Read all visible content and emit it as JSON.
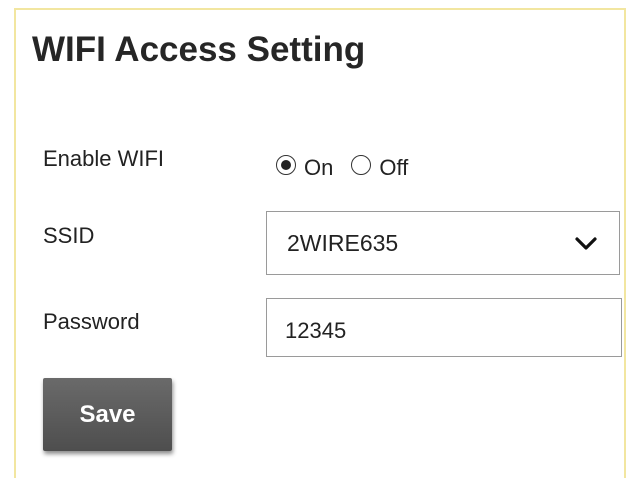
{
  "page": {
    "title": "WIFI Access Setting"
  },
  "enable_wifi": {
    "label": "Enable WIFI",
    "options": [
      {
        "label": "On",
        "selected": true
      },
      {
        "label": "Off",
        "selected": false
      }
    ]
  },
  "ssid": {
    "label": "SSID",
    "value": "2WIRE635",
    "icon": "chevron-down-icon"
  },
  "password": {
    "label": "Password",
    "value": "12345"
  },
  "actions": {
    "save_label": "Save"
  },
  "colors": {
    "panel_border": "#f2e6a0",
    "button_bg": "#5c5c5c",
    "button_text": "#ffffff",
    "field_border": "#9a9a9a"
  }
}
